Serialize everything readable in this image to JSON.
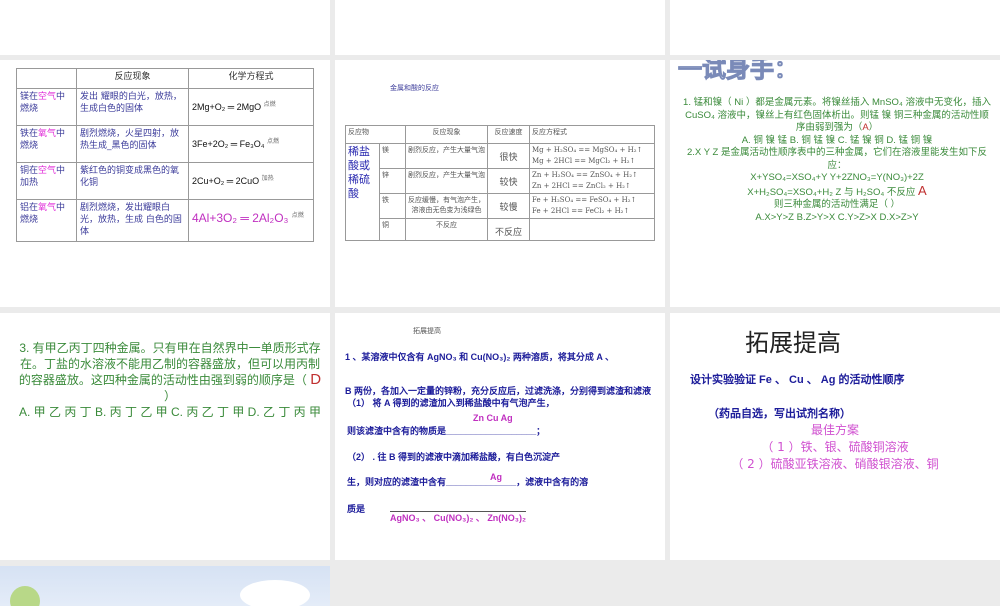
{
  "slide_table": {
    "headers": [
      "",
      "反应现象",
      "化学方程式"
    ],
    "rows": [
      {
        "subject_a": "镁在",
        "gas": "空气",
        "subject_b": "中燃烧",
        "phenomenon": "发出 耀眼的白光，放热，生成白色的固体",
        "equation": "2Mg+O₂ ═ 2MgO",
        "condition": "点燃"
      },
      {
        "subject_a": "铁在",
        "gas": "氧气",
        "subject_b": "中燃烧",
        "phenomenon": "剧烈燃烧，火星四射，放热生成_黑色的固体",
        "equation": "3Fe+2O₂ ═ Fe₃O₄",
        "condition": "点燃"
      },
      {
        "subject_a": "铜在",
        "gas": "空气",
        "subject_b": "中加热",
        "phenomenon": "紫红色的铜变成黑色的氧化铜",
        "equation": "2Cu+O₂ ═ 2CuO",
        "condition": "加热"
      },
      {
        "subject_a": "铝在",
        "gas": "氧气",
        "subject_b": "中燃烧",
        "phenomenon": "剧烈燃烧，发出耀眼白光，放热，生成 白色的固体",
        "equation": "4Al+3O₂ ═ 2Al₂O₃",
        "condition": "点燃"
      }
    ]
  },
  "slide_acid": {
    "title": "金属和酸的反应",
    "headers": [
      "反应物",
      "反应现象",
      "反应速度",
      "反应方程式"
    ],
    "reactant": "稀盐酸或稀硫酸",
    "rows": [
      {
        "metal": "镁",
        "phenomenon": "剧烈反应，产生大量气泡",
        "speed": "很快",
        "eq1": "Mg + H₂SO₄ == MgSO₄ + H₂↑",
        "eq2": "Mg + 2HCl == MgCl₂ + H₂↑"
      },
      {
        "metal": "锌",
        "phenomenon": "剧烈反应，产生大量气泡",
        "speed": "较快",
        "eq1": "Zn + H₂SO₄ == ZnSO₄ + H₂↑",
        "eq2": "Zn + 2HCl == ZnCl₂ + H₂↑"
      },
      {
        "metal": "铁",
        "phenomenon": "反应缓慢，有气泡产生，溶液由无色变为浅绿色",
        "speed": "较慢",
        "eq1": "Fe + H₂SO₄ == FeSO₄ + H₂↑",
        "eq2": "Fe + 2HCl == FeCl₂ + H₂↑"
      },
      {
        "metal": "铜",
        "phenomenon": "不反应",
        "speed": "不反应",
        "eq1": "",
        "eq2": ""
      }
    ]
  },
  "slide_try": {
    "title": "一试身手：",
    "q1": "1. 锰和镍（ Ni ）都是金属元素。将镍丝插入 MnSO₄ 溶液中无变化，插入 CuSO₄ 溶液中，镍丝上有红色固体析出。则锰 镍 铜三种金属的活动性顺序由弱到强为（",
    "q1_answer": "A",
    "q1_close": "）",
    "q1_options": "A. 铜 镍 锰  B. 铜 锰 镍  C. 锰 镍 铜  D. 锰 铜 镍",
    "q2": "2.X Y Z 是金属活动性顺序表中的三种金属，它们在溶液里能发生如下反应：",
    "eqs1": "X+YSO₄=XSO₄+Y    Y+2ZNO₃=Y(NO₃)+2Z",
    "eqs2": "X+H₂SO₄=XSO₄+H₂   Z 与 H₂SO₄ 不反应",
    "q2_answer": "A",
    "q2_ask": "则三种金属的活动性满足（      ）",
    "q2_options": "A.X>Y>Z  B.Z>Y>X  C.Y>Z>X  D.X>Z>Y"
  },
  "slide_q3": {
    "text": "3. 有甲乙丙丁四种金属。只有甲在自然界中一单质形式存在。丁盐的水溶液不能用乙制的容器盛放，但可以用丙制的容器盛放。这四种金属的活动性由强到弱的顺序是（",
    "answer": "D",
    "close": "）",
    "options": "A. 甲 乙 丙 丁  B. 丙 丁 乙 甲   C. 丙 乙 丁 甲  D. 乙 丁 丙 甲"
  },
  "slide_ext": {
    "title": "拓展提高",
    "l1": "1 、某溶液中仅含有 AgNO₃ 和 Cu(NO₃)₂ 两种溶质，将其分成 A 、",
    "l2": "B 两份，各加入一定量的锌粉，充分反应后，过滤洗涤，分别得到滤渣和滤液",
    "l3": "（1） 将 A 得到的滤渣加入到稀盐酸中有气泡产生，",
    "ans1": "Zn Cu Ag",
    "l4": "则该滤渣中含有的物质是__________________；",
    "l5": "（2） . 往 B 得到的滤液中滴加稀盐酸，有白色沉淀产",
    "l6": "生，则对应的滤渣中含有______________，滤液中含有的溶",
    "ans2": "Ag",
    "l7": "质是",
    "ans3": "AgNO₃ 、 Cu(NO₃)₂ 、  Zn(NO₃)₂"
  },
  "slide_design": {
    "title": "拓展提高",
    "l1": "设计实验验证 Fe 、 Cu 、 Ag 的活动性顺序",
    "l2": "（药品自选，写出试剂名称）",
    "best": "最佳方案",
    "opt1": "（ 1 ）铁、银、硫酸铜溶液",
    "opt2": "（ 2 ）硫酸亚铁溶液、硝酸银溶液、铜"
  }
}
